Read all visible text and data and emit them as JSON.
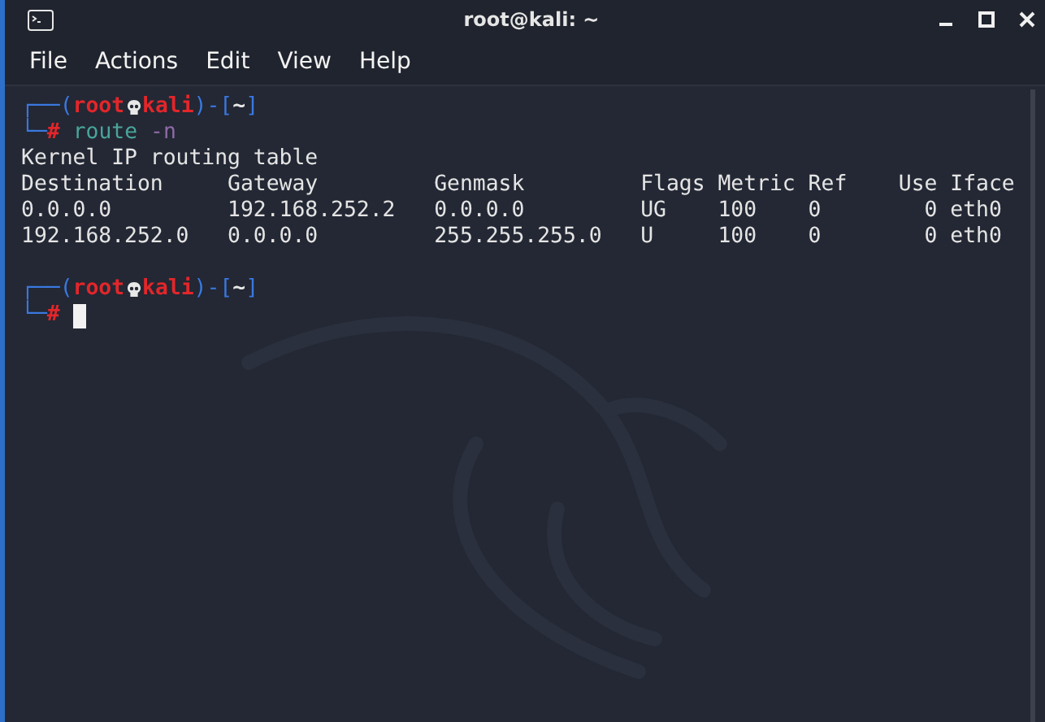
{
  "window": {
    "title": "root@kali: ~"
  },
  "menu": [
    {
      "label": "File"
    },
    {
      "label": "Actions"
    },
    {
      "label": "Edit"
    },
    {
      "label": "View"
    },
    {
      "label": "Help"
    }
  ],
  "terminal": {
    "lines": [
      {
        "kind": "prompt",
        "open": "┌──(",
        "user": "root",
        "host": "kali",
        "mid": ")-[",
        "dir": "~",
        "close": "]"
      },
      {
        "kind": "command",
        "corner": "└─",
        "symbol": "#",
        "command": "route",
        "args": "-n",
        "cursor": false
      },
      {
        "kind": "output",
        "text": "Kernel IP routing table"
      },
      {
        "kind": "output",
        "text": "Destination     Gateway         Genmask         Flags Metric Ref    Use Iface"
      },
      {
        "kind": "output",
        "text": "0.0.0.0         192.168.252.2   0.0.0.0         UG    100    0        0 eth0"
      },
      {
        "kind": "output",
        "text": "192.168.252.0   0.0.0.0         255.255.255.0   U     100    0        0 eth0"
      },
      {
        "kind": "blank"
      },
      {
        "kind": "prompt",
        "open": "┌──(",
        "user": "root",
        "host": "kali",
        "mid": ")-[",
        "dir": "~",
        "close": "]"
      },
      {
        "kind": "command",
        "corner": "└─",
        "symbol": "#",
        "cursor": true
      }
    ]
  }
}
